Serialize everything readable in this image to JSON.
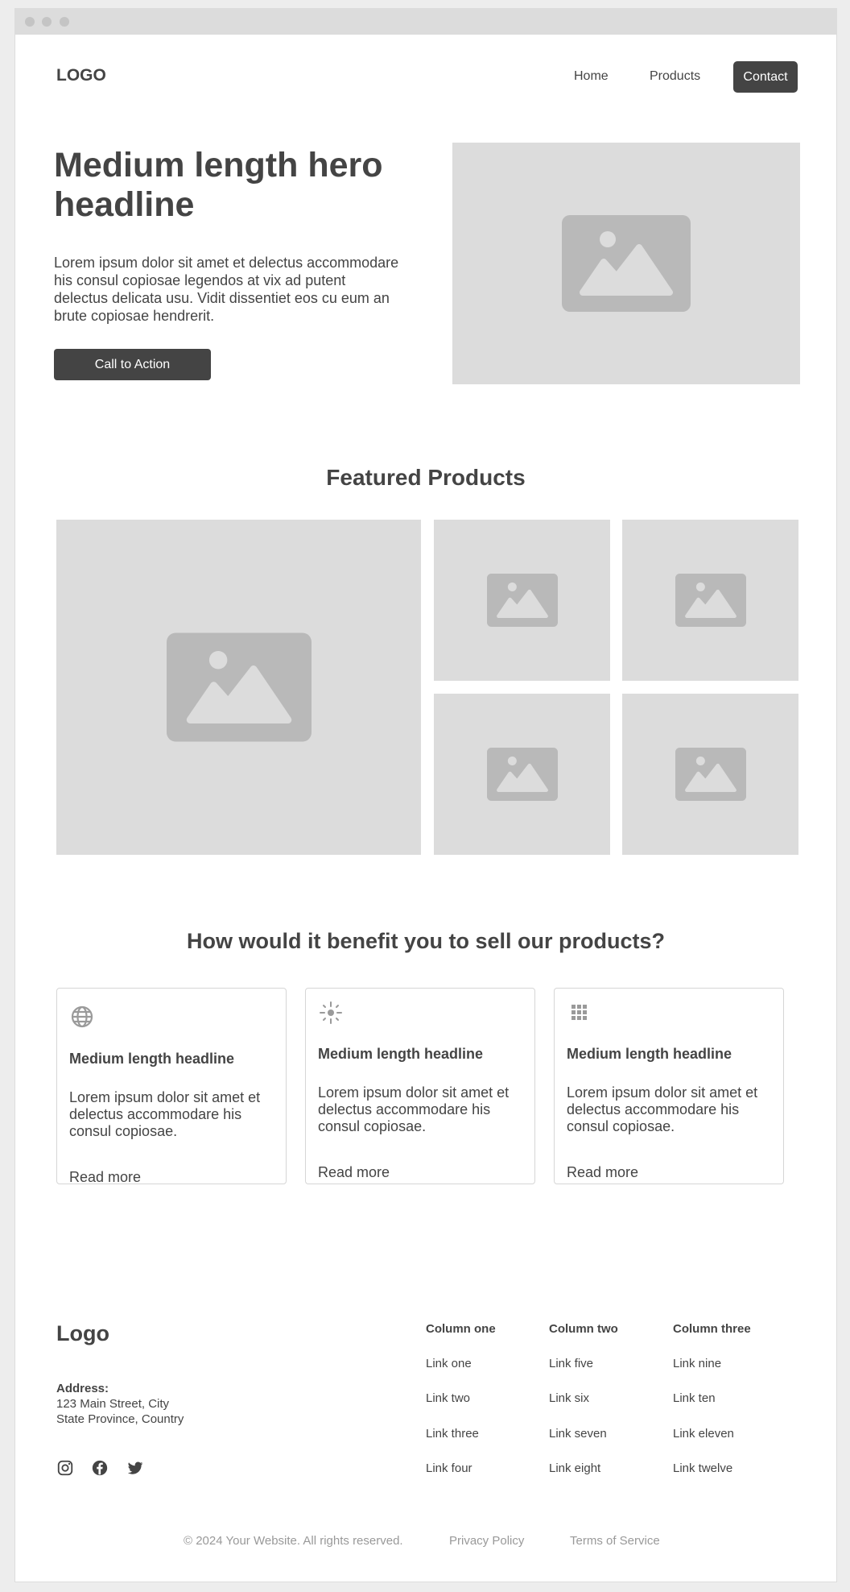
{
  "header": {
    "logo": "LOGO",
    "nav": {
      "home": "Home",
      "products": "Products",
      "contact": "Contact"
    }
  },
  "hero": {
    "headline": "Medium length hero headline",
    "body": "Lorem ipsum dolor sit amet et delectus accommodare his consul copiosae legendos at vix ad putent delectus delicata usu. Vidit dissentiet eos cu eum an brute copiosae hendrerit.",
    "cta": "Call to Action",
    "image_icon": "image-placeholder-icon"
  },
  "featured": {
    "title": "Featured Products",
    "image_icon": "image-placeholder-icon"
  },
  "benefits": {
    "title": "How would it benefit you to sell our products?",
    "cards": [
      {
        "icon": "globe-icon",
        "headline": "Medium length headline",
        "text": "Lorem ipsum dolor sit amet et delectus accommodare his consul copiosae.",
        "link": "Read more"
      },
      {
        "icon": "sun-icon",
        "headline": "Medium length headline",
        "text": "Lorem ipsum dolor sit amet et delectus accommodare his consul copiosae.",
        "link": "Read more"
      },
      {
        "icon": "grid-icon",
        "headline": "Medium length headline",
        "text": "Lorem ipsum dolor sit amet et delectus accommodare his consul copiosae.",
        "link": "Read more"
      }
    ]
  },
  "footer": {
    "logo": "Logo",
    "address_label": "Address:",
    "address_line1": "123 Main Street, City",
    "address_line2": "State Province, Country",
    "social": [
      "instagram-icon",
      "facebook-icon",
      "twitter-icon"
    ],
    "columns": [
      {
        "heading": "Column one",
        "links": [
          "Link one",
          "Link two",
          "Link three",
          "Link four"
        ]
      },
      {
        "heading": "Column two",
        "links": [
          "Link five",
          "Link six",
          "Link seven",
          "Link eight"
        ]
      },
      {
        "heading": "Column three",
        "links": [
          "Link nine",
          "Link ten",
          "Link eleven",
          "Link twelve"
        ]
      }
    ],
    "copyright": "© 2024 Your Website. All rights reserved.",
    "privacy": "Privacy Policy",
    "terms": "Terms of Service"
  },
  "colors": {
    "primary": "#444444",
    "placeholder_bg": "#dcdcdc",
    "placeholder_icon": "#b9b9b9",
    "muted_text": "#999999"
  }
}
